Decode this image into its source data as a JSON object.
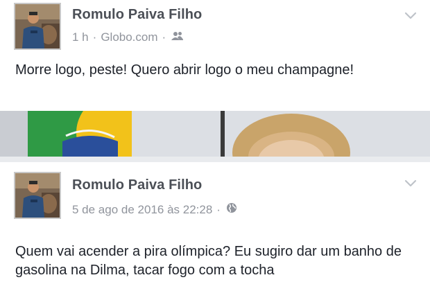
{
  "posts": [
    {
      "author": "Romulo Paiva Filho",
      "time": "1 h",
      "source": "Globo.com",
      "separator": "·",
      "audience_icon": "friends-icon",
      "text": "Morre logo, peste! Quero abrir logo o meu champagne!"
    },
    {
      "author": "Romulo Paiva Filho",
      "time": "5 de ago de 2016 às 22:28",
      "separator": "·",
      "audience_icon": "globe-icon",
      "text": "Quem vai acender a pira olímpica? Eu sugiro dar um banho de gasolina na Dilma, tacar fogo com a tocha"
    }
  ],
  "colors": {
    "name": "#4b4f56",
    "meta": "#90949c",
    "text": "#1d2129",
    "background": "#e9ebee"
  }
}
